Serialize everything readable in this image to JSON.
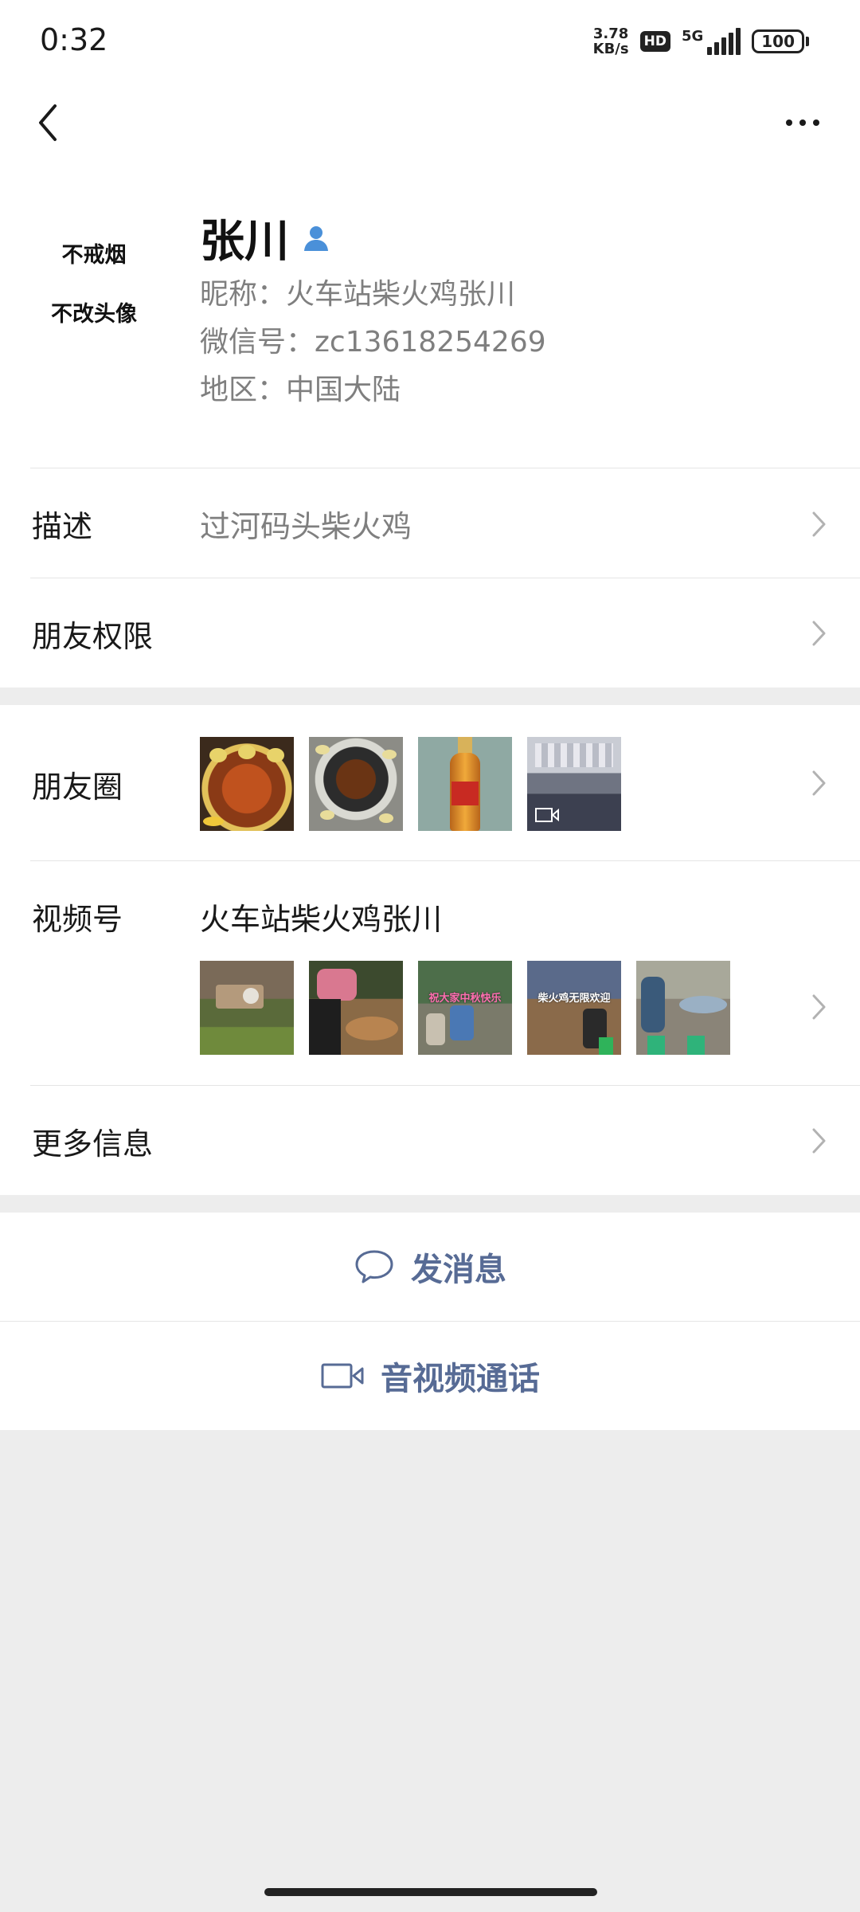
{
  "status_bar": {
    "time": "0:32",
    "net_speed_value": "3.78",
    "net_speed_unit": "KB/s",
    "hd_badge": "HD",
    "signal_label": "5G",
    "battery": "100"
  },
  "nav": {
    "back_icon": "chevron-left-icon",
    "more_icon": "more-dots-icon"
  },
  "profile": {
    "avatar_line1": "不戒烟",
    "avatar_line2": "不改头像",
    "name": "张川",
    "nickname": "昵称：火车站柴火鸡张川",
    "wechat_id": "微信号：zc13618254269",
    "region": "地区：中国大陆"
  },
  "rows": {
    "description": {
      "label": "描述",
      "value": "过河码头柴火鸡"
    },
    "permissions": {
      "label": "朋友权限"
    },
    "moments": {
      "label": "朋友圈"
    },
    "channels": {
      "label": "视频号",
      "value": "火车站柴火鸡张川",
      "thumb3_caption": "祝大家中秋快乐",
      "thumb4_caption": "柴火鸡无限欢迎"
    },
    "more_info": {
      "label": "更多信息"
    }
  },
  "actions": {
    "message": "发消息",
    "call": "音视频通话"
  },
  "colors": {
    "link_blue": "#576b95",
    "page_bg": "#ededed",
    "secondary_text": "#7f7f7f"
  }
}
